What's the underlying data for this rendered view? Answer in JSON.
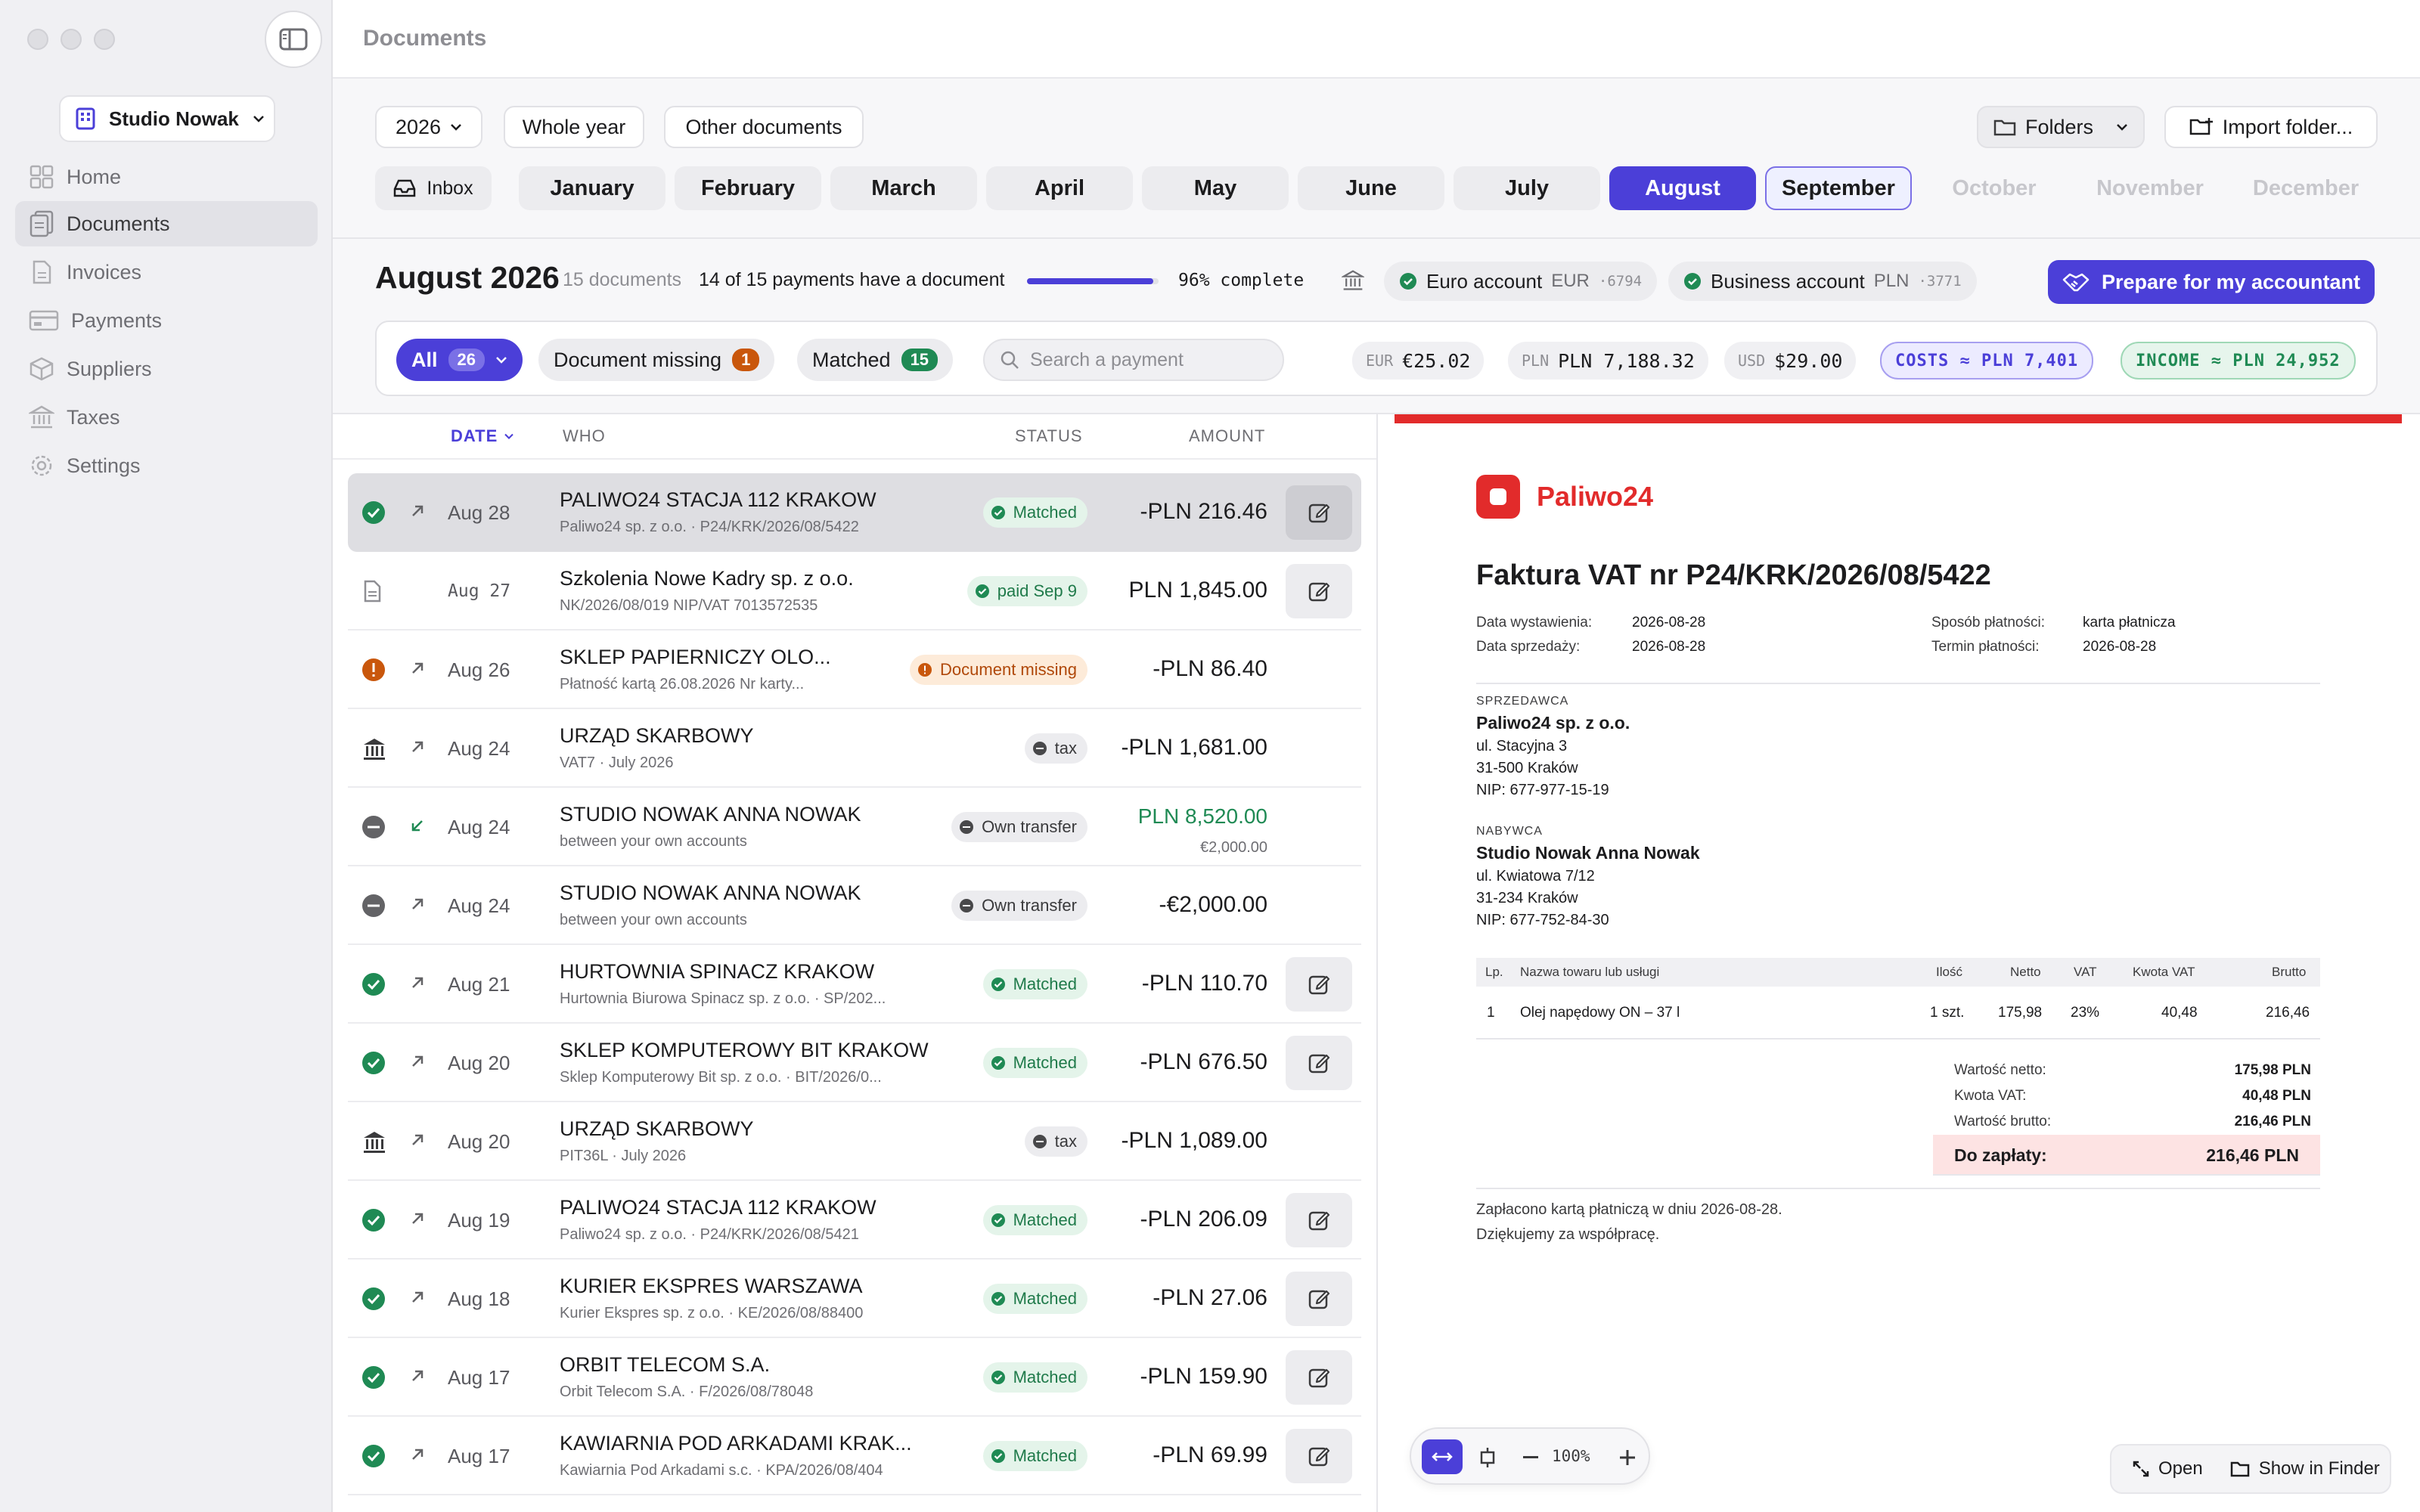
{
  "window": {
    "title": "Documents"
  },
  "sidebar": {
    "workspace": "Studio Nowak",
    "items": [
      {
        "label": "Home",
        "icon": "grid-icon"
      },
      {
        "label": "Documents",
        "icon": "document-icon"
      },
      {
        "label": "Invoices",
        "icon": "file-icon"
      },
      {
        "label": "Payments",
        "icon": "card-icon"
      },
      {
        "label": "Suppliers",
        "icon": "box-icon"
      },
      {
        "label": "Taxes",
        "icon": "bank-icon"
      },
      {
        "label": "Settings",
        "icon": "gear-icon"
      }
    ]
  },
  "toolbar": {
    "year": "2026",
    "whole_year": "Whole year",
    "other_documents": "Other documents",
    "folders": "Folders",
    "import_folder": "Import folder...",
    "inbox": "Inbox",
    "months": [
      "January",
      "February",
      "March",
      "April",
      "May",
      "June",
      "July",
      "August",
      "September",
      "October",
      "November",
      "December"
    ]
  },
  "summary": {
    "period": "August 2026",
    "doc_count": "15 documents",
    "payments_status": "14 of 15 payments have a document",
    "progress_percent": 96,
    "complete_label": "96% complete",
    "accounts": [
      {
        "name": "Euro account",
        "currency": "EUR",
        "number": "·6794"
      },
      {
        "name": "Business account",
        "currency": "PLN",
        "number": "·3771"
      }
    ],
    "prepare": "Prepare for my accountant"
  },
  "filters": {
    "all": "All",
    "all_count": "26",
    "missing": "Document missing",
    "missing_count": "1",
    "matched": "Matched",
    "matched_count": "15",
    "search_placeholder": "Search a payment",
    "totals": [
      {
        "label": "EUR",
        "value": "€25.02"
      },
      {
        "label": "PLN",
        "value": "PLN 7,188.32"
      },
      {
        "label": "USD",
        "value": "$29.00"
      }
    ],
    "costs": "COSTS ≈ PLN 7,401",
    "income": "INCOME ≈ PLN 24,952"
  },
  "table": {
    "headers": {
      "date": "DATE",
      "who": "WHO",
      "status": "STATUS",
      "amount": "AMOUNT"
    },
    "rows": [
      {
        "state": "matched",
        "dir": "out",
        "date": "Aug 28",
        "who": "PALIWO24 STACJA 112 KRAKOW",
        "sub": "Paliwo24 sp. z o.o. · P24/KRK/2026/08/5422",
        "tag": "Matched",
        "tag_kind": "matched",
        "amount": "-PLN 216.46",
        "amount2": "",
        "edit": true,
        "selected": true
      },
      {
        "state": "doc",
        "dir": "",
        "date": "Aug 27",
        "who": "Szkolenia Nowe Kadry sp. z o.o.",
        "sub": "NK/2026/08/019  NIP/VAT 7013572535",
        "tag": "paid Sep 9",
        "tag_kind": "matched",
        "amount": "PLN 1,845.00",
        "amount2": "",
        "edit": true,
        "selected": false
      },
      {
        "state": "missing",
        "dir": "out",
        "date": "Aug 26",
        "who": "SKLEP PAPIERNICZY OLO...",
        "sub": "Płatność kartą 26.08.2026 Nr karty...",
        "tag": "Document missing",
        "tag_kind": "missing",
        "amount": "-PLN 86.40",
        "amount2": "",
        "edit": false,
        "selected": false
      },
      {
        "state": "tax",
        "dir": "out",
        "date": "Aug 24",
        "who": "URZĄD SKARBOWY",
        "sub": "VAT7 · July 2026",
        "tag": "tax",
        "tag_kind": "neutral",
        "amount": "-PLN 1,681.00",
        "amount2": "",
        "edit": false,
        "selected": false
      },
      {
        "state": "transfer",
        "dir": "in",
        "date": "Aug 24",
        "who": "STUDIO NOWAK ANNA NOWAK",
        "sub": "between your own accounts",
        "tag": "Own transfer",
        "tag_kind": "neutral",
        "amount": "PLN 8,520.00",
        "amount2": "€2,000.00",
        "edit": false,
        "selected": false
      },
      {
        "state": "transfer",
        "dir": "out",
        "date": "Aug 24",
        "who": "STUDIO NOWAK ANNA NOWAK",
        "sub": "between your own accounts",
        "tag": "Own transfer",
        "tag_kind": "neutral",
        "amount": "-€2,000.00",
        "amount2": "",
        "edit": false,
        "selected": false
      },
      {
        "state": "matched",
        "dir": "out",
        "date": "Aug 21",
        "who": "HURTOWNIA SPINACZ KRAKOW",
        "sub": "Hurtownia Biurowa Spinacz sp. z o.o. · SP/202...",
        "tag": "Matched",
        "tag_kind": "matched",
        "amount": "-PLN 110.70",
        "amount2": "",
        "edit": true,
        "selected": false
      },
      {
        "state": "matched",
        "dir": "out",
        "date": "Aug 20",
        "who": "SKLEP KOMPUTEROWY BIT KRAKOW",
        "sub": "Sklep Komputerowy Bit sp. z o.o. · BIT/2026/0...",
        "tag": "Matched",
        "tag_kind": "matched",
        "amount": "-PLN 676.50",
        "amount2": "",
        "edit": true,
        "selected": false
      },
      {
        "state": "tax",
        "dir": "out",
        "date": "Aug 20",
        "who": "URZĄD SKARBOWY",
        "sub": "PIT36L · July 2026",
        "tag": "tax",
        "tag_kind": "neutral",
        "amount": "-PLN 1,089.00",
        "amount2": "",
        "edit": false,
        "selected": false
      },
      {
        "state": "matched",
        "dir": "out",
        "date": "Aug 19",
        "who": "PALIWO24 STACJA 112 KRAKOW",
        "sub": "Paliwo24 sp. z o.o. · P24/KRK/2026/08/5421",
        "tag": "Matched",
        "tag_kind": "matched",
        "amount": "-PLN 206.09",
        "amount2": "",
        "edit": true,
        "selected": false
      },
      {
        "state": "matched",
        "dir": "out",
        "date": "Aug 18",
        "who": "KURIER EKSPRES WARSZAWA",
        "sub": "Kurier Ekspres sp. z o.o. · KE/2026/08/88400",
        "tag": "Matched",
        "tag_kind": "matched",
        "amount": "-PLN 27.06",
        "amount2": "",
        "edit": true,
        "selected": false
      },
      {
        "state": "matched",
        "dir": "out",
        "date": "Aug 17",
        "who": "ORBIT TELECOM S.A.",
        "sub": "Orbit Telecom S.A. · F/2026/08/78048",
        "tag": "Matched",
        "tag_kind": "matched",
        "amount": "-PLN 159.90",
        "amount2": "",
        "edit": true,
        "selected": false
      },
      {
        "state": "matched",
        "dir": "out",
        "date": "Aug 17",
        "who": "KAWIARNIA POD ARKADAMI KRAK...",
        "sub": "Kawiarnia Pod Arkadami s.c. · KPA/2026/08/404",
        "tag": "Matched",
        "tag_kind": "matched",
        "amount": "-PLN 69.99",
        "amount2": "",
        "edit": true,
        "selected": false
      }
    ]
  },
  "invoice": {
    "brand": "Paliwo24",
    "title": "Faktura VAT nr P24/KRK/2026/08/5422",
    "issue_date_label": "Data wystawienia:",
    "issue_date": "2026-08-28",
    "sale_date_label": "Data sprzedaży:",
    "sale_date": "2026-08-28",
    "payment_method_label": "Sposób płatności:",
    "payment_method": "karta płatnicza",
    "due_date_label": "Termin płatności:",
    "due_date": "2026-08-28",
    "seller_label": "SPRZEDAWCA",
    "seller": {
      "name": "Paliwo24 sp. z o.o.",
      "street": "ul. Stacyjna 3",
      "city": "31-500 Kraków",
      "nip": "NIP: 677-977-15-19"
    },
    "buyer_label": "NABYWCA",
    "buyer": {
      "name": "Studio Nowak Anna Nowak",
      "street": "ul. Kwiatowa 7/12",
      "city": "31-234 Kraków",
      "nip": "NIP: 677-752-84-30"
    },
    "table_headers": {
      "lp": "Lp.",
      "name": "Nazwa towaru lub usługi",
      "qty": "Ilość",
      "net": "Netto",
      "vat": "VAT",
      "vat_amount": "Kwota VAT",
      "gross": "Brutto"
    },
    "item": {
      "lp": "1",
      "name": "Olej napędowy ON – 37 l",
      "qty": "1 szt.",
      "net": "175,98",
      "vat": "23%",
      "vat_amount": "40,48",
      "gross": "216,46"
    },
    "net_total_label": "Wartość netto:",
    "net_total": "175,98 PLN",
    "vat_total_label": "Kwota VAT:",
    "vat_total": "40,48 PLN",
    "gross_total_label": "Wartość brutto:",
    "gross_total": "216,46 PLN",
    "to_pay_label": "Do zapłaty:",
    "to_pay": "216,46 PLN",
    "note1": "Zapłacono kartą płatniczą w dniu 2026-08-28.",
    "note2": "Dziękujemy za współpracę."
  },
  "preview": {
    "zoom": "100%",
    "open": "Open",
    "finder": "Show in Finder"
  },
  "colors": {
    "accent": "#4b3fd8",
    "matched": "#1f8a54",
    "missing": "#c9570c",
    "brand_red": "#e22b2b"
  }
}
